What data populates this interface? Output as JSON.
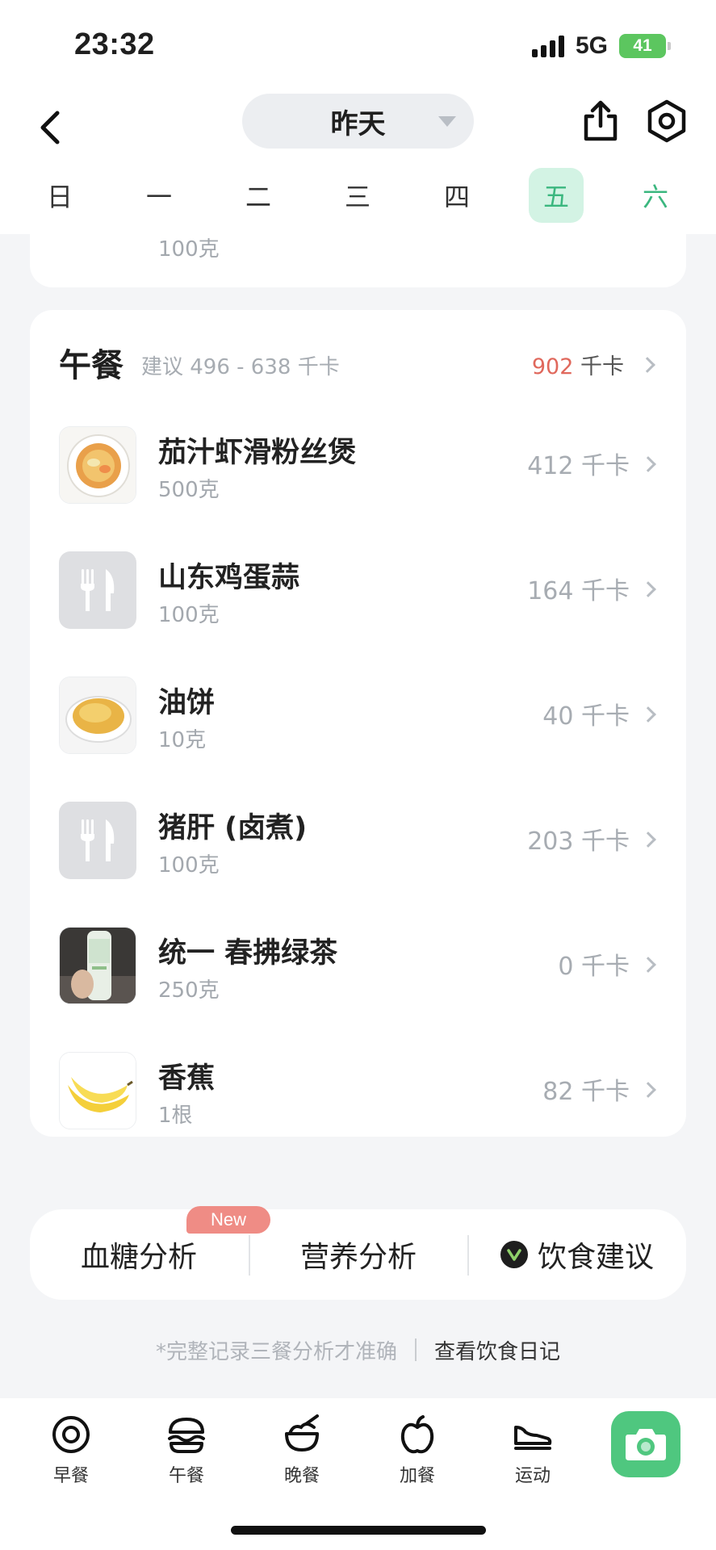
{
  "status_bar": {
    "time": "23:32",
    "network": "5G",
    "battery": "41"
  },
  "nav": {
    "date_label": "昨天"
  },
  "week_days": [
    {
      "label": "日",
      "state": "past"
    },
    {
      "label": "一",
      "state": "past"
    },
    {
      "label": "二",
      "state": "past"
    },
    {
      "label": "三",
      "state": "past"
    },
    {
      "label": "四",
      "state": "past"
    },
    {
      "label": "五",
      "state": "selected"
    },
    {
      "label": "六",
      "state": "future"
    }
  ],
  "previous_item": {
    "amount": "100克"
  },
  "lunch": {
    "title": "午餐",
    "suggestion": "建议 496 - 638 千卡",
    "total_value": "902",
    "total_unit": "千卡",
    "items": [
      {
        "name": "茄汁虾滑粉丝煲",
        "amount": "500克",
        "kcal": "412 千卡",
        "thumb": "dish-bowl"
      },
      {
        "name": "山东鸡蛋蒜",
        "amount": "100克",
        "kcal": "164 千卡",
        "thumb": "fork-knife-placeholder"
      },
      {
        "name": "油饼",
        "amount": "10克",
        "kcal": "40 千卡",
        "thumb": "fried-cake-plate"
      },
      {
        "name": "猪肝 (卤煮)",
        "amount": "100克",
        "kcal": "203 千卡",
        "thumb": "fork-knife-placeholder"
      },
      {
        "name": "统一 春拂绿茶",
        "amount": "250克",
        "kcal": "0 千卡",
        "thumb": "tea-bottle-photo"
      },
      {
        "name": "香蕉",
        "amount": "1根",
        "kcal": "82 千卡",
        "thumb": "banana"
      }
    ]
  },
  "analysis": {
    "blood_sugar": "血糖分析",
    "new_badge": "New",
    "nutrition": "营养分析",
    "diet_advice": "饮食建议"
  },
  "note": {
    "text": "*完整记录三餐分析才准确",
    "link": "查看饮食日记"
  },
  "tabs": [
    {
      "label": "早餐",
      "icon": "breakfast-egg-icon"
    },
    {
      "label": "午餐",
      "icon": "burger-icon"
    },
    {
      "label": "晚餐",
      "icon": "rice-bowl-icon"
    },
    {
      "label": "加餐",
      "icon": "apple-icon"
    },
    {
      "label": "运动",
      "icon": "sneaker-icon"
    }
  ],
  "colors": {
    "accent_green": "#3bb77f",
    "selected_day_bg": "#d3f3e4",
    "calorie_red": "#e0685c",
    "camera_green": "#4fc77f",
    "badge_red": "#ef8c85"
  }
}
